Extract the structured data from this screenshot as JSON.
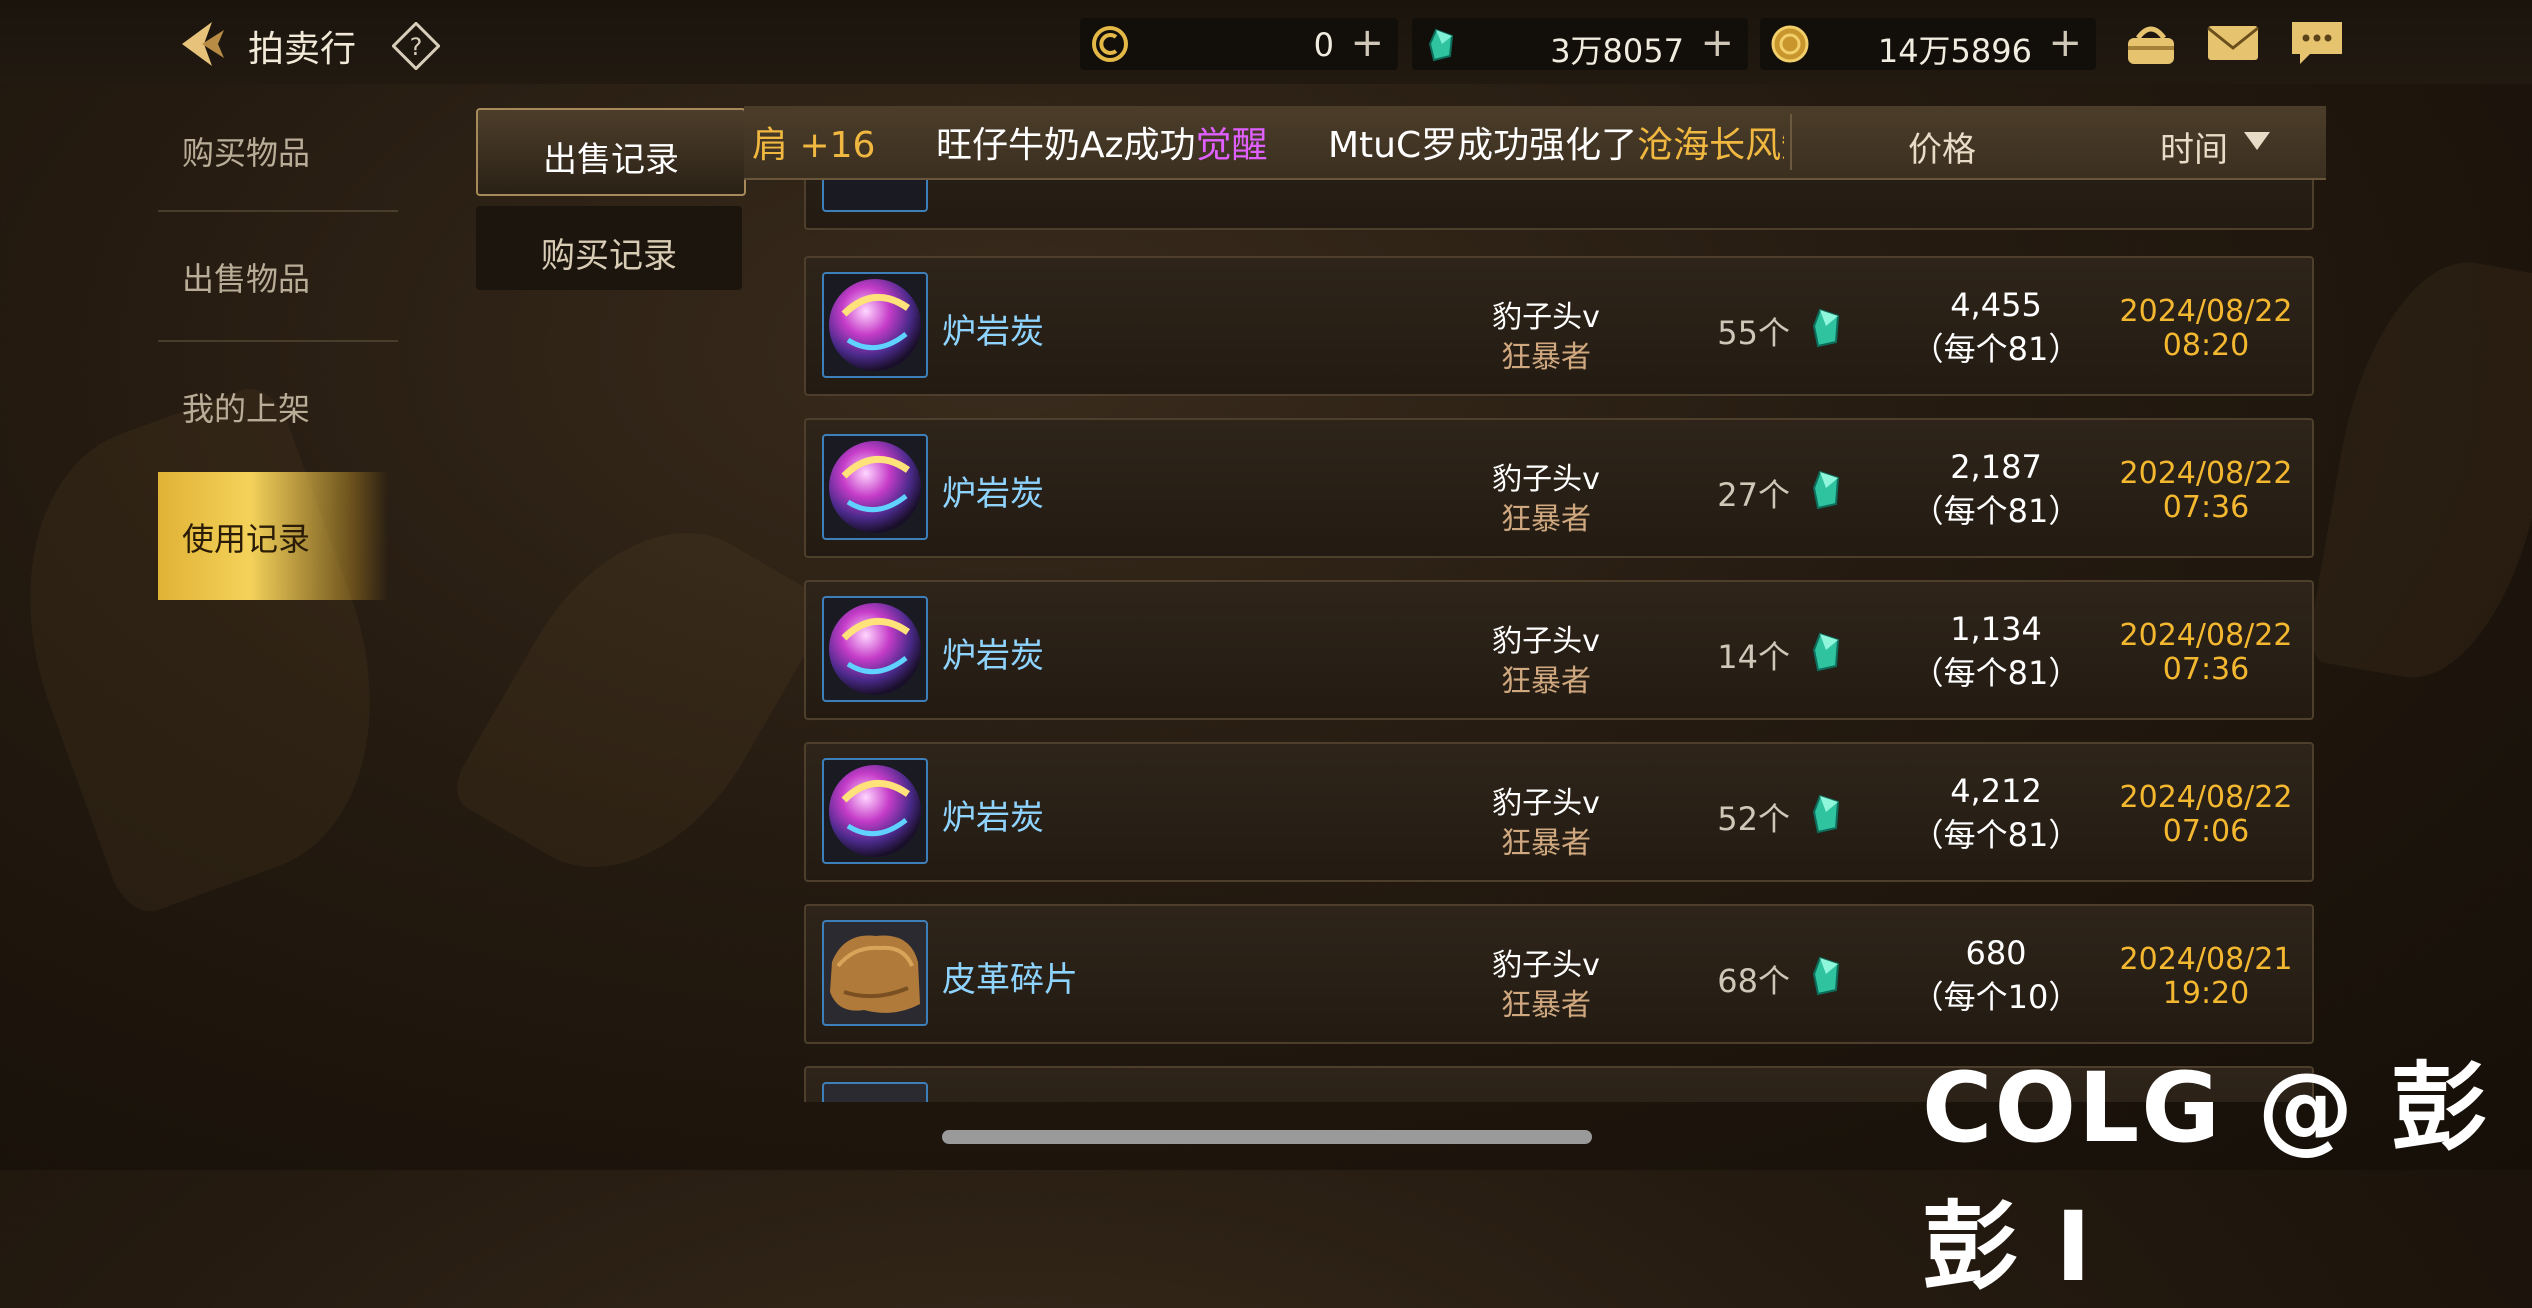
{
  "header": {
    "title": "拍卖行",
    "currencies": [
      {
        "name": "c-coin-icon",
        "value": "0"
      },
      {
        "name": "green-gem-icon",
        "value": "3万8057"
      },
      {
        "name": "gold-coin-icon",
        "value": "14万5896"
      }
    ],
    "plus": "+"
  },
  "nav": {
    "items": [
      "购买物品",
      "出售物品",
      "我的上架",
      "使用记录"
    ],
    "active": "使用记录"
  },
  "subtabs": {
    "sell_log": "出售记录",
    "buy_log": "购买记录"
  },
  "list_header": {
    "price": "价格",
    "time": "时间"
  },
  "ticker": {
    "part1": "肩 +16",
    "part2_prefix": "旺仔牛奶Az成功",
    "part2_highlight": "觉醒",
    "part3_prefix": "MtuC罗成功强化了",
    "part3_highlight": "沧海长风短"
  },
  "records": [
    {
      "item": "炉岩炭",
      "seller": "豹子头v",
      "class": "狂暴者",
      "qty": "55个",
      "total": "4,455",
      "unit": "（每个81）",
      "date": "2024/08/22",
      "time": "08:20"
    },
    {
      "item": "炉岩炭",
      "seller": "豹子头v",
      "class": "狂暴者",
      "qty": "27个",
      "total": "2,187",
      "unit": "（每个81）",
      "date": "2024/08/22",
      "time": "07:36"
    },
    {
      "item": "炉岩炭",
      "seller": "豹子头v",
      "class": "狂暴者",
      "qty": "14个",
      "total": "1,134",
      "unit": "（每个81）",
      "date": "2024/08/22",
      "time": "07:36"
    },
    {
      "item": "炉岩炭",
      "seller": "豹子头v",
      "class": "狂暴者",
      "qty": "52个",
      "total": "4,212",
      "unit": "（每个81）",
      "date": "2024/08/22",
      "time": "07:06"
    },
    {
      "item": "皮革碎片",
      "seller": "豹子头v",
      "class": "狂暴者",
      "qty": "68个",
      "total": "680",
      "unit": "（每个10）",
      "date": "2024/08/21",
      "time": "19:20"
    }
  ],
  "watermark": "COLG @ 彭彭 I"
}
